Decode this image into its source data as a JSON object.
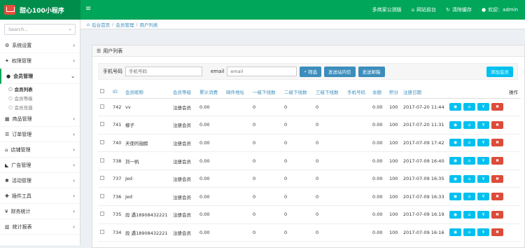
{
  "app": {
    "title": "甜心100小程序"
  },
  "topnav": {
    "store": "多商家公测版",
    "site": "网站前台",
    "cache": "清除缓存",
    "welcome": "欢迎：admin"
  },
  "sidebar": {
    "search_placeholder": "Search...",
    "items": [
      {
        "label": "系统设置"
      },
      {
        "label": "权限管理"
      },
      {
        "label": "会员管理"
      },
      {
        "label": "商品管理"
      },
      {
        "label": "订单管理"
      },
      {
        "label": "店铺管理"
      },
      {
        "label": "广告管理"
      },
      {
        "label": "活动管理"
      },
      {
        "label": "插件工具"
      },
      {
        "label": "财务统计"
      },
      {
        "label": "统计报表"
      }
    ],
    "sub": [
      {
        "label": "会员列表"
      },
      {
        "label": "会员等级"
      },
      {
        "label": "会员充值"
      }
    ]
  },
  "breadcrumb": {
    "home": "后台首页",
    "section": "会员管理",
    "page": "用户列表"
  },
  "panel": {
    "title": "用户列表"
  },
  "filter": {
    "phone_label": "手机号码",
    "phone_placeholder": "手机号码",
    "email_label": "email",
    "email_placeholder": "email",
    "search": "筛选",
    "send_msg": "发送站内信",
    "send_mail": "发送邮箱",
    "add": "添加会员"
  },
  "table": {
    "headers": [
      "ID",
      "会员昵称",
      "会员等级",
      "累计消费",
      "邮件地址",
      "一级下线数",
      "二级下线数",
      "三级下线数",
      "手机号码",
      "余额",
      "积分",
      "注册日期",
      "操作"
    ],
    "rows": [
      {
        "id": "742",
        "name": "vv",
        "level": "注册会员",
        "spent": "0.00",
        "l1": "0",
        "l2": "0",
        "l3": "0",
        "bal": "0.00",
        "pts": "100",
        "date": "2017-07-20 11:44"
      },
      {
        "id": "741",
        "name": "檬子",
        "level": "注册会员",
        "spent": "0.00",
        "l1": "0",
        "l2": "0",
        "l3": "0",
        "bal": "0.00",
        "pts": "100",
        "date": "2017-07-20 11:31"
      },
      {
        "id": "740",
        "name": "天使的翅膀",
        "level": "注册会员",
        "spent": "0.00",
        "l1": "0",
        "l2": "0",
        "l3": "0",
        "bal": "0.00",
        "pts": "100",
        "date": "2017-07-09 17:42"
      },
      {
        "id": "738",
        "name": "刘一帆",
        "level": "注册会员",
        "spent": "0.00",
        "l1": "0",
        "l2": "0",
        "l3": "0",
        "bal": "0.00",
        "pts": "100",
        "date": "2017-07-09 16:40"
      },
      {
        "id": "737",
        "name": "Jed",
        "level": "注册会员",
        "spent": "0.00",
        "l1": "0",
        "l2": "0",
        "l3": "0",
        "bal": "0.00",
        "pts": "100",
        "date": "2017-07-09 16:35"
      },
      {
        "id": "736",
        "name": "Jed",
        "level": "注册会员",
        "spent": "0.00",
        "l1": "0",
        "l2": "0",
        "l3": "0",
        "bal": "0.00",
        "pts": "100",
        "date": "2017-07-09 16:33"
      },
      {
        "id": "735",
        "name": "段 遇18908432221",
        "level": "注册会员",
        "spent": "0.00",
        "l1": "0",
        "l2": "0",
        "l3": "0",
        "bal": "0.00",
        "pts": "100",
        "date": "2017-07-09 16:19"
      },
      {
        "id": "734",
        "name": "段 遇18908432221",
        "level": "注册会员",
        "spent": "0.00",
        "l1": "0",
        "l2": "0",
        "l3": "0",
        "bal": "0.00",
        "pts": "100",
        "date": "2017-07-09 16:16"
      }
    ]
  }
}
